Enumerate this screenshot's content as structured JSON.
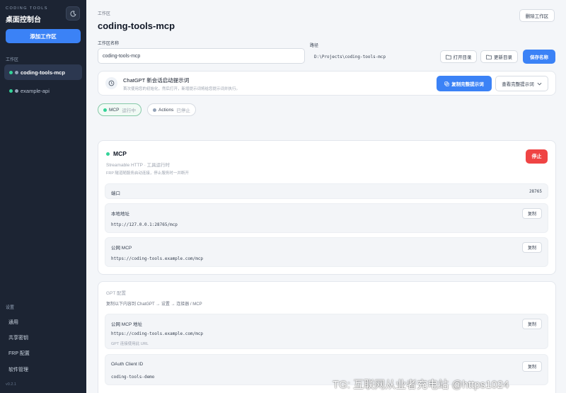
{
  "sidebar": {
    "brand_small": "CODING TOOLS",
    "brand": "桌面控制台",
    "add_workspace": "添加工作区",
    "workspace_section": "工作区",
    "workspaces": [
      {
        "name": "coding-tools-mcp",
        "status": "running"
      },
      {
        "name": "example-api",
        "status": "stopped"
      }
    ],
    "settings_section": "设置",
    "nav": [
      "通用",
      "共享密钥",
      "FRP 配置",
      "软件管理"
    ],
    "version": "v0.2.1"
  },
  "header": {
    "small": "工作区",
    "title": "coding-tools-mcp",
    "delete_button": "删除工作区"
  },
  "form": {
    "name_label": "工作区名称",
    "name_value": "coding-tools-mcp",
    "path_label": "路径",
    "path_value": "D:\\Projects\\coding-tools-mcp",
    "open_dir": "打开目录",
    "update_dir": "更新目录",
    "save_name": "保存名称"
  },
  "banner": {
    "title": "ChatGPT 新会话启动提示词",
    "subtitle": "首次使用您的初始化，然后打开，新增提示词将给您提示词并执行。",
    "copy_button": "复制完整提示词",
    "view_button": "查看完整提示词"
  },
  "pills": [
    {
      "label": "MCP",
      "status": "运行中"
    },
    {
      "label": "Actions",
      "status": "已停止"
    }
  ],
  "mcp_card": {
    "title": "MCP",
    "subtitle": "Streamable HTTP · 工具运行时",
    "note": "FRP 隧道随服务启动连接，停止服务时一并断开",
    "stop_button": "停止",
    "port_label": "端口",
    "port_value": "28765",
    "local_label": "本地地址",
    "local_value": "http://127.0.0.1:28765/mcp",
    "public_label": "公网 MCP",
    "public_value": "https://coding-tools.example.com/mcp",
    "copy_label": "复制"
  },
  "gpt_card": {
    "title": "GPT 配置",
    "subtitle": "复制以下内容到 ChatGPT → 设置 → 连接器 / MCP",
    "public_label": "公网 MCP 地址",
    "public_value": "https://coding-tools.example.com/mcp",
    "public_note": "GPT 连接使用此 URL",
    "client_label": "OAuth Client ID",
    "client_value": "coding-tools-demo",
    "copy_label": "复制"
  },
  "watermark": "TG: 互联网从业者充电站 @https1024",
  "colors": {
    "sidebar_bg": "#1c2433",
    "accent": "#3b82f6",
    "danger": "#ef4444",
    "running": "#34d399"
  }
}
